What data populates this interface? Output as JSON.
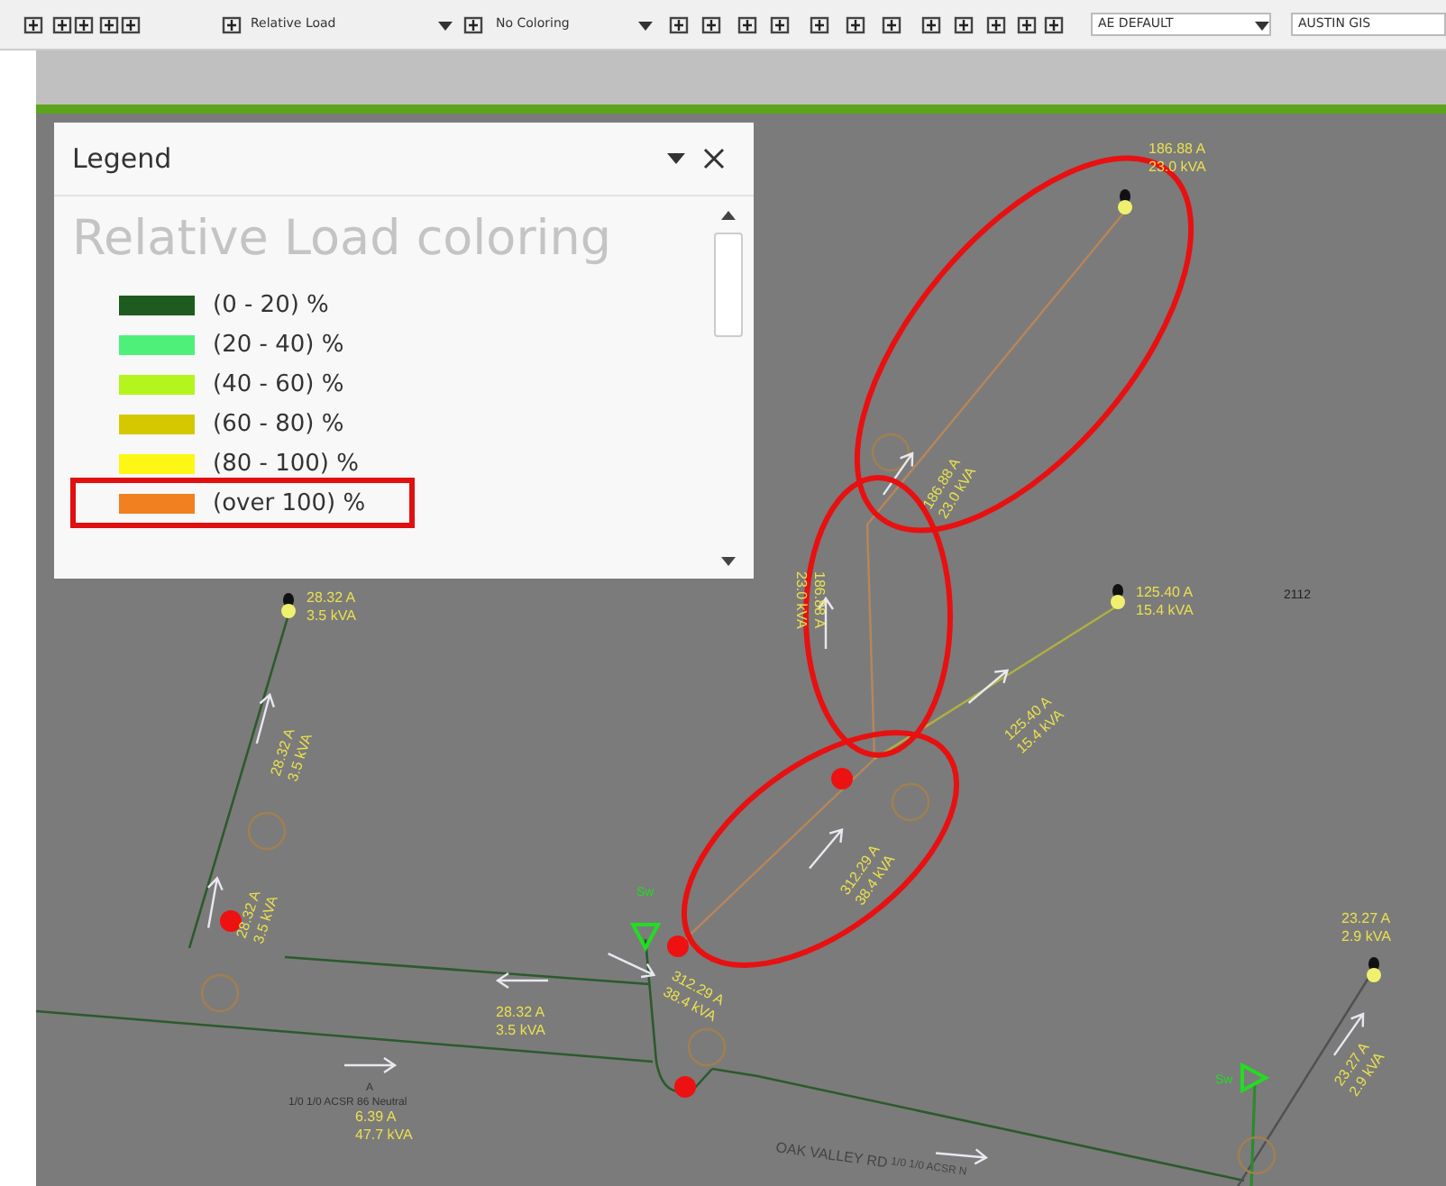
{
  "toolbar": {
    "load_dropdown": {
      "value": "Relative Load"
    },
    "coloring_dropdown": {
      "value": "No Coloring"
    },
    "theme_dropdown": {
      "value": "AE DEFAULT"
    },
    "map_dropdown": {
      "value": "AUSTIN GIS"
    }
  },
  "legend": {
    "title": "Legend",
    "heading": "Relative Load coloring",
    "items": [
      {
        "label": "(0 - 20) %",
        "color": "#1e5b1e",
        "highlighted": false
      },
      {
        "label": "(20 - 40) %",
        "color": "#4ef07a",
        "highlighted": false
      },
      {
        "label": "(40 - 60) %",
        "color": "#b4f51e",
        "highlighted": false
      },
      {
        "label": "(60 - 80) %",
        "color": "#d6c800",
        "highlighted": false
      },
      {
        "label": "(80 - 100) %",
        "color": "#fcf714",
        "highlighted": false
      },
      {
        "label": "(over 100) %",
        "color": "#f08020",
        "highlighted": true
      }
    ]
  },
  "map": {
    "load_labels": [
      {
        "amps": "186.88 A",
        "kva": "23.0 kVA"
      },
      {
        "amps": "186.88 A",
        "kva": "23.0 kVA"
      },
      {
        "amps": "186.88 A",
        "kva": "23.0 kVA"
      },
      {
        "amps": "28.32 A",
        "kva": "3.5 kVA"
      },
      {
        "amps": "125.40 A",
        "kva": "15.4 kVA"
      },
      {
        "amps": "28.32 A",
        "kva": "3.5 kVA"
      },
      {
        "amps": "125.40 A",
        "kva": "15.4 kVA"
      },
      {
        "amps": "28.32 A",
        "kva": "3.5 kVA"
      },
      {
        "amps": "312.29 A",
        "kva": "38.4 kVA"
      },
      {
        "amps": "23.27 A",
        "kva": "2.9 kVA"
      },
      {
        "amps": "312.29 A",
        "kva": "38.4 kVA"
      },
      {
        "amps": "28.32 A",
        "kva": "3.5 kVA"
      },
      {
        "amps": "23.27 A",
        "kva": "2.9 kVA"
      },
      {
        "amps": "6.39 A",
        "kva": "47.7 kVA"
      }
    ],
    "annotations": [
      {
        "text": "2112"
      },
      {
        "text": "A"
      },
      {
        "text": "1/0 1/0 ACSR 86 Neutral"
      },
      {
        "text": "OAK VALLEY RD"
      },
      {
        "text": "1/0 1/0 ACSR N"
      }
    ],
    "switches": [
      {
        "label": "Sw"
      },
      {
        "label": "Sw"
      }
    ]
  }
}
